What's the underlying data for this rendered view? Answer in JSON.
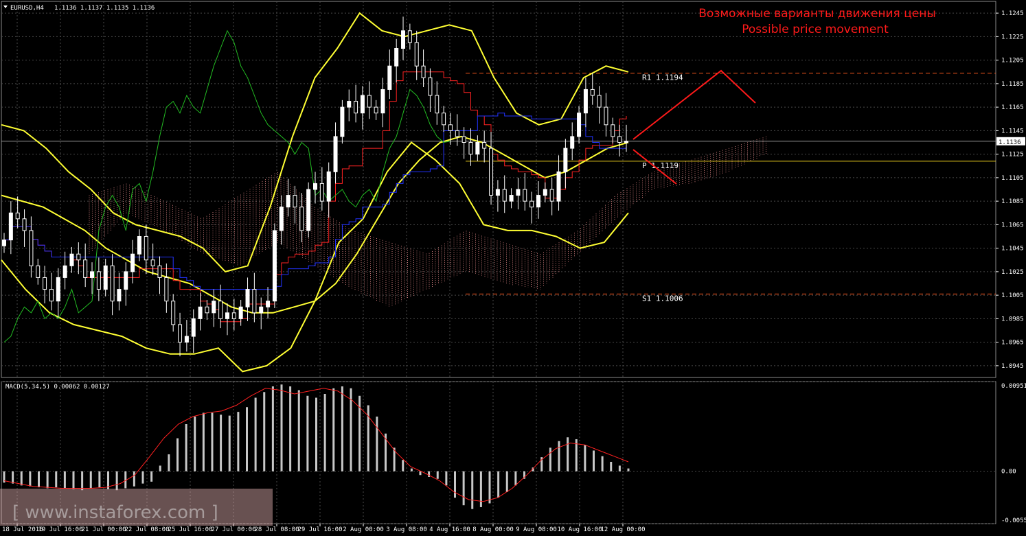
{
  "header": {
    "symbol": "EURUSD,H4",
    "ohlc": "1.1136 1.1137 1.1135 1.1136"
  },
  "annotation": {
    "line1": "Возможные варианты движения цены",
    "line2": "Possible price movement",
    "color": "#ff1a1a"
  },
  "watermark": "[ www.instaforex.com ]",
  "macd_label": "MACD(5,34,5) 0.00062 0.00127",
  "current_price": "1.1136",
  "colors": {
    "background": "#000000",
    "grid": "#4a4a4a",
    "candle": "#ffffff",
    "tenkan": "#ff2222",
    "kijun": "#2233ff",
    "chikou": "#22bb22",
    "bollinger": "#ffff33",
    "cloud": "#c87878",
    "macd_hist": "#c8c8c8",
    "macd_signal": "#ff2020",
    "pivot_r1": "#ff5a1e",
    "pivot_p": "#e6c81e",
    "pivot_s1": "#ff5a1e"
  },
  "chart_data": [
    {
      "type": "candlestick",
      "symbol": "EURUSD",
      "timeframe": "H4",
      "ylim": [
        1.0935,
        1.1255
      ],
      "y_ticks": [
        "1.1245",
        "1.1225",
        "1.1205",
        "1.1185",
        "1.1165",
        "1.1145",
        "1.1125",
        "1.1105",
        "1.1085",
        "1.1065",
        "1.1045",
        "1.1025",
        "1.1005",
        "1.0985",
        "1.0965",
        "1.0945"
      ],
      "x_ticks": [
        "18 Jul 2016",
        "19 Jul 16:00",
        "21 Jul 00:00",
        "22 Jul 08:00",
        "25 Jul 16:00",
        "27 Jul 00:00",
        "28 Jul 08:00",
        "29 Jul 16:00",
        "2 Aug 00:00",
        "3 Aug 08:00",
        "4 Aug 16:00",
        "8 Aug 00:00",
        "9 Aug 08:00",
        "10 Aug 16:00",
        "12 Aug 00:00"
      ],
      "levels": [
        {
          "label": "R1",
          "value": 1.1194
        },
        {
          "label": "P",
          "value": 1.1119
        },
        {
          "label": "S1",
          "value": 1.1006
        }
      ],
      "close_path": [
        1.1052,
        1.1075,
        1.107,
        1.106,
        1.103,
        1.102,
        1.101,
        1.1,
        1.102,
        1.103,
        1.104,
        1.1035,
        1.102,
        1.1025,
        1.101,
        1.103,
        1.1,
        1.101,
        1.1025,
        1.104,
        1.1055,
        1.1035,
        1.103,
        1.102,
        1.1,
        1.098,
        1.0965,
        1.097,
        1.0985,
        1.0995,
        1.099,
        1.1,
        1.0985,
        1.099,
        1.0985,
        1.0995,
        1.101,
        1.099,
        1.0995,
        1.1,
        1.106,
        1.108,
        1.109,
        1.108,
        1.106,
        1.1095,
        1.11,
        1.1085,
        1.111,
        1.114,
        1.1165,
        1.117,
        1.116,
        1.1175,
        1.1165,
        1.116,
        1.118,
        1.12,
        1.1215,
        1.123,
        1.122,
        1.12,
        1.119,
        1.1175,
        1.116,
        1.115,
        1.1145,
        1.114,
        1.1135,
        1.1125,
        1.1135,
        1.113,
        1.109,
        1.1095,
        1.1085,
        1.109,
        1.1095,
        1.1085,
        1.108,
        1.109,
        1.1095,
        1.1085,
        1.111,
        1.113,
        1.114,
        1.116,
        1.118,
        1.1175,
        1.1165,
        1.115,
        1.114,
        1.1135,
        1.1136
      ],
      "bollinger_mid": [
        1.109,
        1.1085,
        1.108,
        1.107,
        1.106,
        1.1045,
        1.1035,
        1.1025,
        1.102,
        1.1015,
        1.1005,
        1.0995,
        1.099,
        1.099,
        1.0995,
        1.1,
        1.1015,
        1.104,
        1.107,
        1.11,
        1.112,
        1.1135,
        1.114,
        1.1135,
        1.1125,
        1.1115,
        1.1105,
        1.111,
        1.112,
        1.113,
        1.1135
      ],
      "bollinger_upper": [
        1.115,
        1.1145,
        1.113,
        1.111,
        1.1095,
        1.1075,
        1.1065,
        1.106,
        1.1055,
        1.1045,
        1.1025,
        1.103,
        1.108,
        1.114,
        1.119,
        1.1215,
        1.1245,
        1.123,
        1.1225,
        1.123,
        1.1235,
        1.123,
        1.119,
        1.116,
        1.115,
        1.1155,
        1.119,
        1.12,
        1.1195
      ],
      "bollinger_lower": [
        1.1035,
        1.101,
        1.099,
        1.098,
        1.0975,
        1.097,
        1.096,
        1.0955,
        1.0955,
        1.096,
        1.094,
        1.0945,
        1.096,
        1.1,
        1.105,
        1.107,
        1.111,
        1.1135,
        1.112,
        1.11,
        1.1065,
        1.106,
        1.106,
        1.1055,
        1.1045,
        1.105,
        1.1075
      ]
    },
    {
      "type": "bar",
      "name": "MACD(5,34,5)",
      "values_label": "0.00062 0.00127",
      "ylim": [
        -0.00555,
        0.00951
      ],
      "y_ticks": [
        "0.00951",
        "0.00",
        "-0.00555"
      ],
      "histogram": [
        -0.0012,
        -0.0013,
        -0.0015,
        -0.0016,
        -0.0017,
        -0.0018,
        -0.0017,
        -0.0018,
        -0.0019,
        -0.002,
        -0.0018,
        -0.0017,
        -0.0019,
        -0.002,
        -0.0018,
        -0.0016,
        -0.0013,
        -0.0011,
        0.0006,
        0.0018,
        0.0035,
        0.005,
        0.0058,
        0.0062,
        0.0062,
        0.006,
        0.0059,
        0.0063,
        0.0068,
        0.0078,
        0.0084,
        0.009,
        0.0092,
        0.009,
        0.0086,
        0.008,
        0.0078,
        0.0082,
        0.0088,
        0.009,
        0.0088,
        0.008,
        0.007,
        0.0058,
        0.004,
        0.0025,
        0.0012,
        0.0003,
        -0.0004,
        -0.0006,
        -0.0008,
        -0.0015,
        -0.0028,
        -0.0036,
        -0.004,
        -0.0038,
        -0.0034,
        -0.0028,
        -0.0022,
        -0.0015,
        -0.0008,
        0.0004,
        0.0015,
        0.0025,
        0.0032,
        0.0036,
        0.0034,
        0.0028,
        0.0022,
        0.0016,
        0.001,
        0.0006,
        0.0003
      ],
      "signal": [
        -0.001,
        -0.0013,
        -0.0016,
        -0.0017,
        -0.0018,
        -0.0018,
        -0.0018,
        -0.0017,
        -0.0013,
        -0.0004,
        0.0015,
        0.0035,
        0.005,
        0.0058,
        0.0062,
        0.0064,
        0.007,
        0.008,
        0.0088,
        0.0086,
        0.0082,
        0.0085,
        0.0088,
        0.0085,
        0.0075,
        0.006,
        0.004,
        0.002,
        0.0005,
        -0.0002,
        -0.001,
        -0.0022,
        -0.003,
        -0.0032,
        -0.0028,
        -0.0018,
        -0.0004,
        0.0012,
        0.0024,
        0.003,
        0.0028,
        0.0022,
        0.0016,
        0.001
      ]
    }
  ]
}
